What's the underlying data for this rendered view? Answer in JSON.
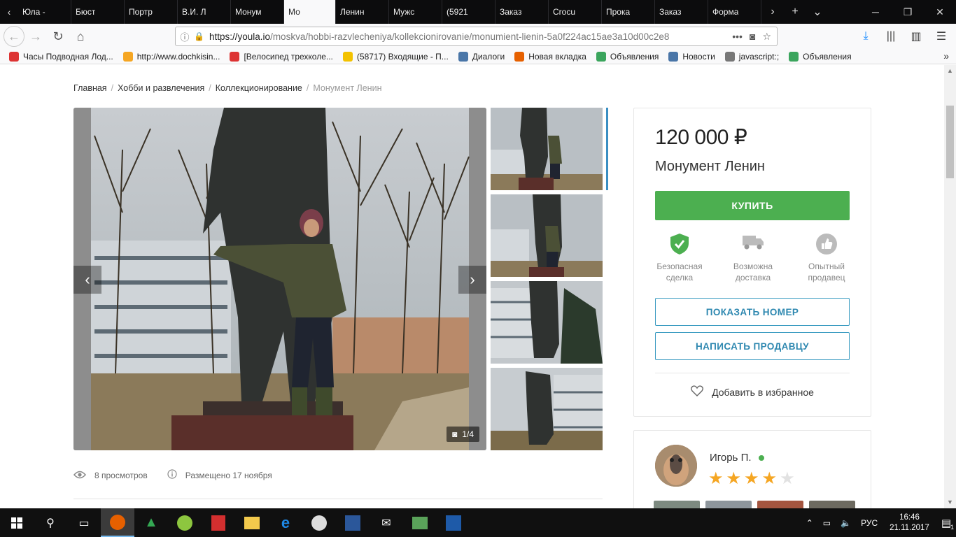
{
  "browser": {
    "tabs": [
      {
        "label": "Юла -",
        "color": "#f3c200"
      },
      {
        "label": "Бюст",
        "color": "#f3c200"
      },
      {
        "label": "Портр",
        "color": "#f3c200"
      },
      {
        "label": "В.И. Л",
        "color": "#f3c200"
      },
      {
        "label": "Монум",
        "color": "#f3c200"
      },
      {
        "label": "Мо",
        "color": "#f3c200",
        "active": true
      },
      {
        "label": "Ленин",
        "color": "#f3c200"
      },
      {
        "label": "Мужс",
        "color": "#e0457b"
      },
      {
        "label": "(5921",
        "color": "#f3c200"
      },
      {
        "label": "Заказ",
        "color": "#cc3333"
      },
      {
        "label": "Crocu",
        "color": "#555555"
      },
      {
        "label": "Прока",
        "color": "#ffffff"
      },
      {
        "label": "Заказ",
        "color": "#b3c832"
      },
      {
        "label": "Форма",
        "color": "#555555"
      }
    ],
    "url_host": "https://youla.io",
    "url_path": "/moskva/hobbi-razvlecheniya/kollekcionirovanie/monumient-lienin-5a0f224ac15ae3a10d00c2e8",
    "bookmarks": [
      {
        "label": "Часы Подводная Лод...",
        "color": "#d33"
      },
      {
        "label": "http://www.dochkisin...",
        "color": "#f5a623"
      },
      {
        "label": "[Велосипед трехколе...",
        "color": "#d33"
      },
      {
        "label": "(58717) Входящие - П...",
        "color": "#f3c200"
      },
      {
        "label": "Диалоги",
        "color": "#4a76a8"
      },
      {
        "label": "Новая вкладка",
        "color": "#e66000"
      },
      {
        "label": "Объявления",
        "color": "#3ba55d"
      },
      {
        "label": "Новости",
        "color": "#4a76a8"
      },
      {
        "label": "javascript:;",
        "color": "#777777"
      },
      {
        "label": "Объявления",
        "color": "#3ba55d"
      }
    ]
  },
  "breadcrumb": {
    "items": [
      "Главная",
      "Хобби и развлечения",
      "Коллекционирование"
    ],
    "current": "Монумент Ленин"
  },
  "gallery": {
    "counter": "1/4"
  },
  "meta": {
    "views": "8 просмотров",
    "posted": "Размещено 17 ноября"
  },
  "product": {
    "price": "120 000 ₽",
    "title": "Монумент Ленин",
    "buy_label": "КУПИТЬ",
    "features": [
      {
        "line1": "Безопасная",
        "line2": "сделка",
        "icon": "shield-check-icon"
      },
      {
        "line1": "Возможна",
        "line2": "доставка",
        "icon": "truck-icon"
      },
      {
        "line1": "Опытный",
        "line2": "продавец",
        "icon": "thumbs-up-badge-icon"
      }
    ],
    "show_number_label": "ПОКАЗАТЬ НОМЕР",
    "write_seller_label": "НАПИСАТЬ ПРОДАВЦУ",
    "favorite_label": "Добавить в избранное",
    "accent_green": "#4caf50",
    "accent_blue": "#3a9bc1"
  },
  "seller": {
    "name": "Игорь П.",
    "rating": 4,
    "rating_max": 5
  },
  "taskbar": {
    "lang": "РУС",
    "time": "16:46",
    "date": "21.11.2017",
    "notifications": "1"
  }
}
